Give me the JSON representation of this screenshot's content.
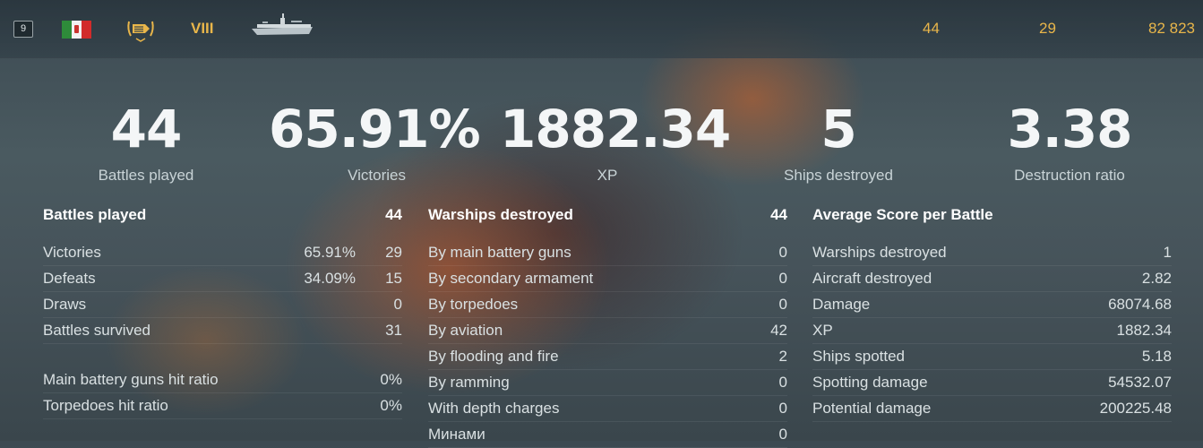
{
  "header": {
    "rank_badge": "9",
    "tier": "VIII",
    "icons": {
      "flag": "italy-flag-icon",
      "class": "aircraft-carrier-class-icon",
      "ship": "ship-silhouette-icon"
    },
    "battles": "44",
    "wins": "29",
    "damage_total": "82 823"
  },
  "summary": [
    {
      "value": "44",
      "label": "Battles played"
    },
    {
      "value": "65.91%",
      "label": "Victories"
    },
    {
      "value": "1882.34",
      "label": "XP"
    },
    {
      "value": "5",
      "label": "Ships destroyed"
    },
    {
      "value": "3.38",
      "label": "Destruction ratio"
    }
  ],
  "battles_col": {
    "title": "Battles played",
    "title_value": "44",
    "rows": [
      {
        "label": "Victories",
        "pct": "65.91%",
        "value": "29"
      },
      {
        "label": "Defeats",
        "pct": "34.09%",
        "value": "15"
      },
      {
        "label": "Draws",
        "pct": "",
        "value": "0"
      },
      {
        "label": "Battles survived",
        "pct": "",
        "value": "31"
      }
    ],
    "rows2": [
      {
        "label": "Main battery guns hit ratio",
        "value": "0%"
      },
      {
        "label": "Torpedoes hit ratio",
        "value": "0%"
      }
    ]
  },
  "warships_col": {
    "title": "Warships destroyed",
    "title_value": "44",
    "rows": [
      {
        "label": "By main battery guns",
        "value": "0"
      },
      {
        "label": "By secondary armament",
        "value": "0"
      },
      {
        "label": "By torpedoes",
        "value": "0"
      },
      {
        "label": "By aviation",
        "value": "42"
      },
      {
        "label": "By flooding and fire",
        "value": "2"
      },
      {
        "label": "By ramming",
        "value": "0"
      },
      {
        "label": "With depth charges",
        "value": "0"
      },
      {
        "label": "Минами",
        "value": "0"
      }
    ]
  },
  "average_col": {
    "title": "Average Score per Battle",
    "rows": [
      {
        "label": "Warships destroyed",
        "value": "1"
      },
      {
        "label": "Aircraft destroyed",
        "value": "2.82"
      },
      {
        "label": "Damage",
        "value": "68074.68"
      },
      {
        "label": "XP",
        "value": "1882.34"
      },
      {
        "label": "Ships spotted",
        "value": "5.18"
      },
      {
        "label": "Spotting damage",
        "value": "54532.07"
      },
      {
        "label": "Potential damage",
        "value": "200225.48"
      }
    ]
  }
}
